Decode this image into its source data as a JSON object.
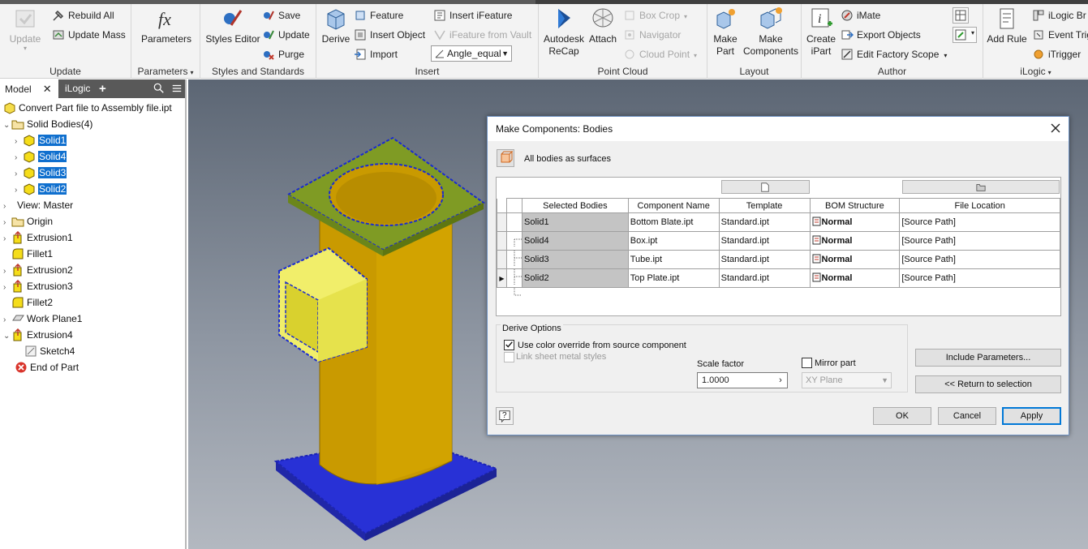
{
  "ribbon": {
    "update": {
      "update_label": "Update",
      "rebuild_all": "Rebuild All",
      "update_mass": "Update Mass",
      "title": "Update"
    },
    "parameters": {
      "parameters_label": "Parameters",
      "title": "Parameters"
    },
    "styles": {
      "styles_editor": "Styles Editor",
      "save": "Save",
      "update": "Update",
      "purge": "Purge",
      "title": "Styles and Standards"
    },
    "insert": {
      "derive": "Derive",
      "feature": "Feature",
      "insert_object": "Insert Object",
      "import": "Import",
      "insert_ifeature": "Insert iFeature",
      "ifeature_from_vault": "iFeature from Vault",
      "rule_combo": "Angle_equal",
      "title": "Insert"
    },
    "point_cloud": {
      "autodesk_recap": "Autodesk ReCap",
      "attach": "Attach",
      "box_crop": "Box Crop",
      "navigator": "Navigator",
      "cloud_point": "Cloud Point",
      "title": "Point Cloud"
    },
    "layout": {
      "make_part": "Make Part",
      "make_components": "Make Components",
      "title": "Layout"
    },
    "author": {
      "create_ipart": "Create iPart",
      "imate": "iMate",
      "export_objects": "Export Objects",
      "edit_factory_scope": "Edit Factory Scope",
      "title": "Author"
    },
    "ilogic": {
      "add_rule": "Add Rule",
      "ilogic_browser": "iLogic Br",
      "event_triggers": "Event Trig",
      "itrigger": "iTrigger",
      "title": "iLogic"
    }
  },
  "browser": {
    "tabs": [
      "Model",
      "iLogic"
    ],
    "root": "Convert Part file to Assembly file.ipt",
    "items": [
      {
        "label": "Solid Bodies(4)"
      },
      {
        "label": "Solid1"
      },
      {
        "label": "Solid4"
      },
      {
        "label": "Solid3"
      },
      {
        "label": "Solid2"
      },
      {
        "label": "View: Master"
      },
      {
        "label": "Origin"
      },
      {
        "label": "Extrusion1"
      },
      {
        "label": "Fillet1"
      },
      {
        "label": "Extrusion2"
      },
      {
        "label": "Extrusion3"
      },
      {
        "label": "Fillet2"
      },
      {
        "label": "Work Plane1"
      },
      {
        "label": "Extrusion4"
      },
      {
        "label": "Sketch4"
      },
      {
        "label": "End of Part"
      }
    ]
  },
  "dialog": {
    "title": "Make Components: Bodies",
    "all_bodies_label": "All bodies as surfaces",
    "columns": [
      "Selected Bodies",
      "Component Name",
      "Template",
      "BOM Structure",
      "File Location"
    ],
    "rows": [
      {
        "body": "Solid1",
        "name": "Bottom Blate.ipt",
        "template": "Standard.ipt",
        "bom": "Normal",
        "location": "[Source Path]"
      },
      {
        "body": "Solid4",
        "name": "Box.ipt",
        "template": "Standard.ipt",
        "bom": "Normal",
        "location": "[Source Path]"
      },
      {
        "body": "Solid3",
        "name": "Tube.ipt",
        "template": "Standard.ipt",
        "bom": "Normal",
        "location": "[Source Path]"
      },
      {
        "body": "Solid2",
        "name": "Top Plate.ipt",
        "template": "Standard.ipt",
        "bom": "Normal",
        "location": "[Source Path]"
      }
    ],
    "derive_options_title": "Derive Options",
    "use_color_override": "Use color override from source component",
    "use_color_override_checked": true,
    "link_sheet_metal": "Link sheet metal styles",
    "scale_factor_label": "Scale factor",
    "scale_factor_value": "1.0000",
    "mirror_part_label": "Mirror part",
    "mirror_plane": "XY Plane",
    "include_parameters": "Include Parameters...",
    "return_to_selection": "<< Return to selection",
    "ok": "OK",
    "cancel": "Cancel",
    "apply": "Apply",
    "help": "?"
  },
  "colors": {
    "selection_blue": "#0f6fce",
    "tube_yellow": "#d4a000",
    "plate_green": "#7a9c2a",
    "base_blue": "#2a35d8"
  }
}
